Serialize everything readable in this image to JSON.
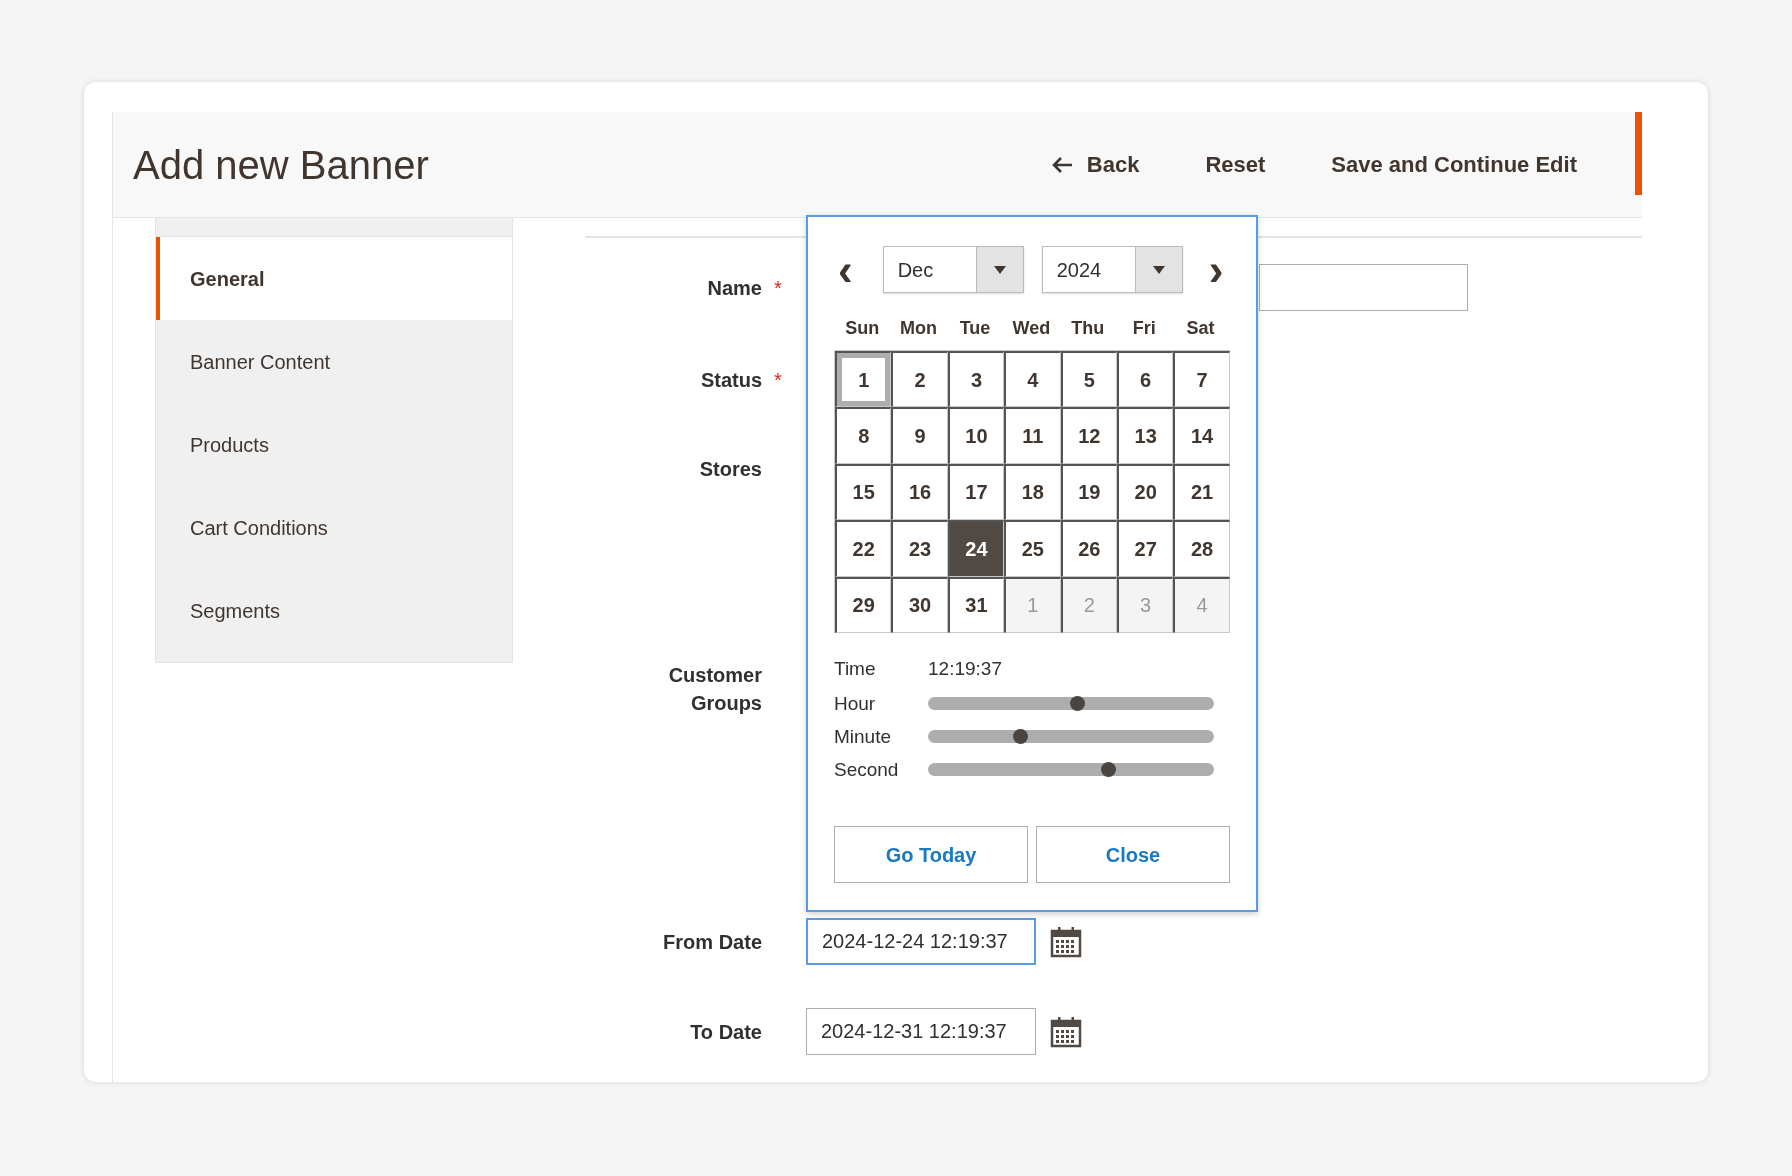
{
  "page": {
    "title": "Add new Banner"
  },
  "actions": [
    {
      "kind": "back",
      "label": "Back"
    },
    {
      "kind": "plain",
      "label": "Reset"
    },
    {
      "kind": "plain",
      "label": "Save and Continue Edit"
    }
  ],
  "sidebar": {
    "items": [
      {
        "label": "General",
        "selected": true
      },
      {
        "label": "Banner Content",
        "selected": false
      },
      {
        "label": "Products",
        "selected": false
      },
      {
        "label": "Cart Conditions",
        "selected": false
      },
      {
        "label": "Segments",
        "selected": false
      }
    ]
  },
  "form": {
    "fields": [
      {
        "label": "Name",
        "required_mark": "*",
        "kind": "text"
      },
      {
        "label": "Status",
        "required_mark": "*",
        "kind": "covered"
      },
      {
        "label": "Stores",
        "kind": "covered"
      },
      {
        "label": "Customer Groups",
        "kind": "covered"
      },
      {
        "label": "From Date",
        "kind": "date",
        "value": "2024-12-24 12:19:37",
        "focused": true
      },
      {
        "label": "To Date",
        "kind": "date",
        "value": "2024-12-31 12:19:37",
        "focused": false
      }
    ]
  },
  "datepicker": {
    "month": "Dec",
    "year": "2024",
    "prev": "‹",
    "next": "›",
    "weekdays": [
      "Sun",
      "Mon",
      "Tue",
      "Wed",
      "Thu",
      "Fri",
      "Sat"
    ],
    "weeks": [
      [
        {
          "label": "1",
          "selected": false,
          "focused": true,
          "other_month": false
        },
        {
          "label": "2",
          "selected": false,
          "focused": false,
          "other_month": false
        },
        {
          "label": "3",
          "selected": false,
          "focused": false,
          "other_month": false
        },
        {
          "label": "4",
          "selected": false,
          "focused": false,
          "other_month": false
        },
        {
          "label": "5",
          "selected": false,
          "focused": false,
          "other_month": false
        },
        {
          "label": "6",
          "selected": false,
          "focused": false,
          "other_month": false
        },
        {
          "label": "7",
          "selected": false,
          "focused": false,
          "other_month": false
        }
      ],
      [
        {
          "label": "8",
          "selected": false,
          "focused": false,
          "other_month": false
        },
        {
          "label": "9",
          "selected": false,
          "focused": false,
          "other_month": false
        },
        {
          "label": "10",
          "selected": false,
          "focused": false,
          "other_month": false
        },
        {
          "label": "11",
          "selected": false,
          "focused": false,
          "other_month": false
        },
        {
          "label": "12",
          "selected": false,
          "focused": false,
          "other_month": false
        },
        {
          "label": "13",
          "selected": false,
          "focused": false,
          "other_month": false
        },
        {
          "label": "14",
          "selected": false,
          "focused": false,
          "other_month": false
        }
      ],
      [
        {
          "label": "15",
          "selected": false,
          "focused": false,
          "other_month": false
        },
        {
          "label": "16",
          "selected": false,
          "focused": false,
          "other_month": false
        },
        {
          "label": "17",
          "selected": false,
          "focused": false,
          "other_month": false
        },
        {
          "label": "18",
          "selected": false,
          "focused": false,
          "other_month": false
        },
        {
          "label": "19",
          "selected": false,
          "focused": false,
          "other_month": false
        },
        {
          "label": "20",
          "selected": false,
          "focused": false,
          "other_month": false
        },
        {
          "label": "21",
          "selected": false,
          "focused": false,
          "other_month": false
        }
      ],
      [
        {
          "label": "22",
          "selected": false,
          "focused": false,
          "other_month": false
        },
        {
          "label": "23",
          "selected": false,
          "focused": false,
          "other_month": false
        },
        {
          "label": "24",
          "selected": true,
          "focused": false,
          "other_month": false
        },
        {
          "label": "25",
          "selected": false,
          "focused": false,
          "other_month": false
        },
        {
          "label": "26",
          "selected": false,
          "focused": false,
          "other_month": false
        },
        {
          "label": "27",
          "selected": false,
          "focused": false,
          "other_month": false
        },
        {
          "label": "28",
          "selected": false,
          "focused": false,
          "other_month": false
        }
      ],
      [
        {
          "label": "29",
          "selected": false,
          "focused": false,
          "other_month": false
        },
        {
          "label": "30",
          "selected": false,
          "focused": false,
          "other_month": false
        },
        {
          "label": "31",
          "selected": false,
          "focused": false,
          "other_month": false
        },
        {
          "label": "1",
          "selected": false,
          "focused": false,
          "other_month": true
        },
        {
          "label": "2",
          "selected": false,
          "focused": false,
          "other_month": true
        },
        {
          "label": "3",
          "selected": false,
          "focused": false,
          "other_month": true
        },
        {
          "label": "4",
          "selected": false,
          "focused": false,
          "other_month": true
        }
      ]
    ],
    "time": {
      "label": "Time",
      "value": "12:19:37"
    },
    "sliders": [
      {
        "label": "Hour",
        "level": 0.52
      },
      {
        "label": "Minute",
        "level": 0.32
      },
      {
        "label": "Second",
        "level": 0.63
      }
    ],
    "buttons": [
      "Go Today",
      "Close"
    ]
  }
}
